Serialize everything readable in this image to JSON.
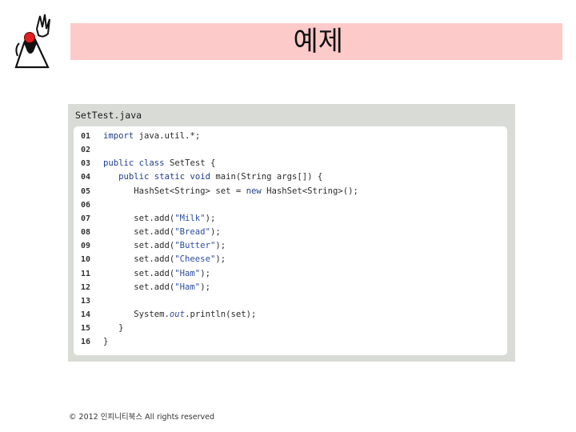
{
  "slide": {
    "title": "예제",
    "copyright": "© 2012 인피니티북스  All rights reserved"
  },
  "code_panel": {
    "file_title": "SetTest.java",
    "lines": [
      {
        "no": "01",
        "text": "import java.util.*;"
      },
      {
        "no": "02",
        "text": ""
      },
      {
        "no": "03",
        "text": "public class SetTest {"
      },
      {
        "no": "04",
        "text": "   public static void main(String args[]) {"
      },
      {
        "no": "05",
        "text": "      HashSet<String> set = new HashSet<String>();"
      },
      {
        "no": "06",
        "text": ""
      },
      {
        "no": "07",
        "text": "      set.add(\"Milk\");"
      },
      {
        "no": "08",
        "text": "      set.add(\"Bread\");"
      },
      {
        "no": "09",
        "text": "      set.add(\"Butter\");"
      },
      {
        "no": "10",
        "text": "      set.add(\"Cheese\");"
      },
      {
        "no": "11",
        "text": "      set.add(\"Ham\");"
      },
      {
        "no": "12",
        "text": "      set.add(\"Ham\");"
      },
      {
        "no": "13",
        "text": ""
      },
      {
        "no": "14",
        "text": "      System.out.println(set);"
      },
      {
        "no": "15",
        "text": "   }"
      },
      {
        "no": "16",
        "text": "}"
      }
    ]
  },
  "icons": {
    "mascot": "java-duke-mascot-icon"
  },
  "colors": {
    "title_bar": "#fdcaca",
    "panel": "#d9dcd6"
  }
}
